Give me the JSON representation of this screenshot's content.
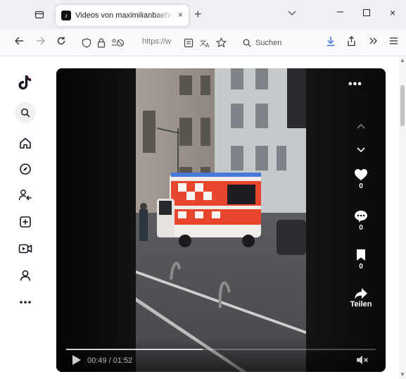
{
  "tab": {
    "title": "Videos von maximilianbaehring",
    "close": "×",
    "new_tab": "+"
  },
  "window": {
    "minimize": "–",
    "close": "×"
  },
  "nav": {
    "url": "https://w",
    "search_placeholder": "Suchen"
  },
  "icons": {
    "back": "arrow-left-icon",
    "forward": "arrow-right-icon",
    "reload": "reload-icon",
    "shield": "shield-icon",
    "lock": "lock-icon",
    "download": "download-icon"
  },
  "sidebar": {
    "items": [
      {
        "name": "tiktok-logo-icon"
      },
      {
        "name": "search-icon"
      },
      {
        "name": "home-icon"
      },
      {
        "name": "explore-icon"
      },
      {
        "name": "following-icon"
      },
      {
        "name": "upload-icon"
      },
      {
        "name": "live-icon"
      },
      {
        "name": "profile-icon"
      },
      {
        "name": "more-icon"
      }
    ]
  },
  "video": {
    "likes": "0",
    "comments": "0",
    "saves": "0",
    "share_label": "Teilen",
    "time": "00:49 / 01:52",
    "progress": 0.44
  },
  "colors": {
    "tab_bar": "#f0f0f4",
    "nav_bar": "#f9f9fb",
    "ambulance_red": "#e8452f",
    "video_bg": "#0b0b0b"
  }
}
